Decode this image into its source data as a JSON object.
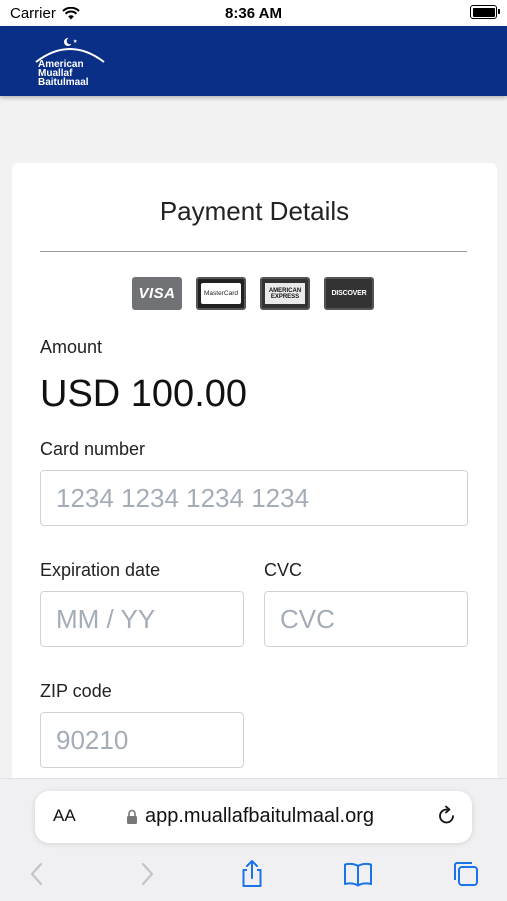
{
  "status_bar": {
    "carrier": "Carrier",
    "time": "8:36 AM"
  },
  "header": {
    "logo_lines": [
      "American",
      "Muallaf",
      "Baitulmaal"
    ],
    "background": "#0a2f86"
  },
  "payment": {
    "title": "Payment Details",
    "card_brands": [
      {
        "name": "visa",
        "label": "VISA"
      },
      {
        "name": "mastercard",
        "label": "MasterCard"
      },
      {
        "name": "american-express",
        "label": "AMERICAN EXPRESS"
      },
      {
        "name": "discover",
        "label": "DISCOVER"
      }
    ],
    "amount_label": "Amount",
    "amount_value": "USD 100.00",
    "card_number_label": "Card number",
    "card_number_placeholder": "1234 1234 1234 1234",
    "expiration_label": "Expiration date",
    "expiration_placeholder": "MM / YY",
    "cvc_label": "CVC",
    "cvc_placeholder": "CVC",
    "zip_label": "ZIP code",
    "zip_placeholder": "90210"
  },
  "browser": {
    "text_size_button": "AA",
    "url": "app.muallafbaitulmaal.org",
    "icons": [
      "back-icon",
      "forward-icon",
      "share-icon",
      "bookmarks-icon",
      "tabs-icon",
      "reload-icon",
      "lock-icon"
    ]
  }
}
